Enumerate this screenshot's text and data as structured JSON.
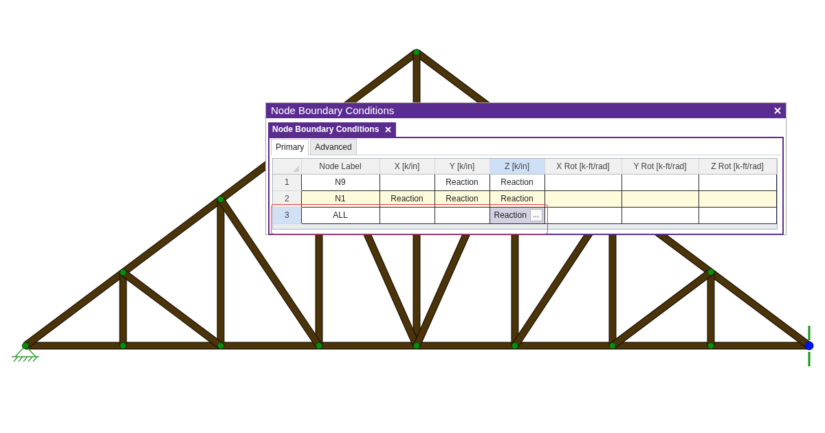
{
  "window": {
    "title": "Node Boundary Conditions"
  },
  "document_tab": {
    "label": "Node Boundary Conditions"
  },
  "tabs": [
    {
      "label": "Primary",
      "selected": true
    },
    {
      "label": "Advanced",
      "selected": false
    }
  ],
  "grid": {
    "columns": [
      {
        "label": "Node Label",
        "active": false
      },
      {
        "label": "X [k/in]",
        "active": false
      },
      {
        "label": "Y [k/in]",
        "active": false
      },
      {
        "label": "Z [k/in]",
        "active": true
      },
      {
        "label": "X Rot [k-ft/rad]",
        "active": false
      },
      {
        "label": "Y Rot [k-ft/rad]",
        "active": false
      },
      {
        "label": "Z Rot [k-ft/rad]",
        "active": false
      }
    ],
    "rows": [
      {
        "number": "1",
        "node_label": "N9",
        "y": "Reaction",
        "z": "Reaction",
        "selected": false,
        "active": false,
        "outlined": false
      },
      {
        "number": "2",
        "node_label": "N1",
        "x": "Reaction",
        "y": "Reaction",
        "z": "Reaction",
        "selected": true,
        "active": false,
        "outlined": false
      },
      {
        "number": "3",
        "node_label": "ALL",
        "z": "Reaction",
        "editor_button": "...",
        "selected": false,
        "active": true,
        "outlined": true
      }
    ]
  }
}
